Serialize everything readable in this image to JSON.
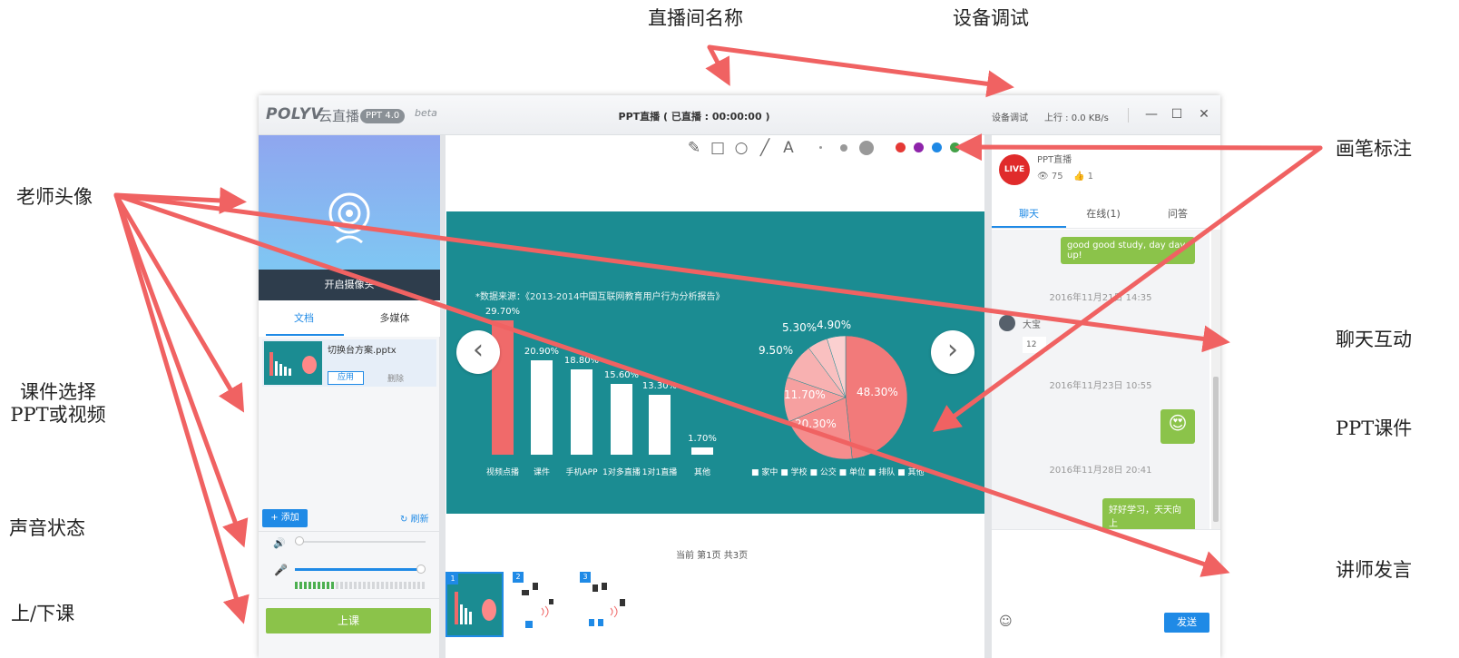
{
  "annotations": {
    "room_name": "直播间名称",
    "device_test": "设备调试",
    "teacher_avatar": "老师头像",
    "courseware_select_1": "课件选择",
    "courseware_select_2": "PPT或视频",
    "sound_status": "声音状态",
    "class_toggle": "上/下课",
    "pen_annotation": "画笔标注",
    "chat_interaction": "聊天互动",
    "ppt_courseware": "PPT课件",
    "teacher_speech": "讲师发言"
  },
  "titlebar": {
    "logo": "POLYV",
    "logo_cn": "云直播",
    "version": "PPT 4.0",
    "beta": "beta",
    "title": "PPT直播 ( 已直播 : 00:00:00 )",
    "device_test": "设备调试",
    "upload_speed": "上行 : 0.0 KB/s"
  },
  "left": {
    "camera_button": "开启摄像头",
    "tabs": [
      "文档",
      "多媒体"
    ],
    "doc_name": "切换台方案.pptx",
    "apply": "应用",
    "delete": "删除",
    "add": "+ 添加",
    "refresh": "刷新",
    "speaker_level": 0.0,
    "mic_level": 1.0,
    "class_button": "上课"
  },
  "toolbar": {
    "tools": [
      "pencil-icon",
      "rectangle-icon",
      "circle-icon",
      "line-icon",
      "text-icon"
    ],
    "colors": [
      "#e53935",
      "#8e24aa",
      "#1e88e5",
      "#43a047",
      "#fb8c00",
      "#263238",
      "#ffffff"
    ],
    "undo": "undo-icon",
    "clear": "close-icon",
    "delete": "trash-icon"
  },
  "slide": {
    "source": "*数据来源：《2013-2014中国互联网教育用户行为分析报告》",
    "bars": [
      {
        "label": "视频点播",
        "value": "29.70%"
      },
      {
        "label": "课件",
        "value": "20.90%"
      },
      {
        "label": "手机APP",
        "value": "18.80%"
      },
      {
        "label": "1对多直播",
        "value": "15.60%"
      },
      {
        "label": "1对1直播",
        "value": "13.30%"
      },
      {
        "label": "其他",
        "value": "1.70%"
      }
    ],
    "pie_labels": [
      "48.30%",
      "20.30%",
      "11.70%",
      "9.50%",
      "5.30%",
      "4.90%"
    ],
    "legend": "■ 家中  ■ 学校  ■ 公交  ■ 单位  ■ 排队  ■ 其他"
  },
  "chart_data": {
    "type": "bar",
    "categories": [
      "视频点播",
      "课件",
      "手机APP",
      "1对多直播",
      "1对1直播",
      "其他"
    ],
    "values": [
      29.7,
      20.9,
      18.8,
      15.6,
      13.3,
      1.7
    ],
    "title": "",
    "xlabel": "",
    "ylabel": "",
    "pie": {
      "values": [
        48.3,
        20.3,
        11.7,
        9.5,
        5.3,
        4.9
      ],
      "legend": [
        "家中",
        "学校",
        "公交",
        "单位",
        "排队",
        "其他"
      ]
    }
  },
  "center": {
    "page_info": "当前 第1页  共3页",
    "thumbs": [
      "1",
      "2",
      "3"
    ]
  },
  "right": {
    "room_name": "PPT直播",
    "views": "75",
    "likes": "1",
    "tabs": [
      "聊天",
      "在线(1)",
      "问答"
    ],
    "msg1": "good good study, day day up!",
    "ts1": "2016年11月21日 14:35",
    "user": "大宝",
    "ts2": "2016年11月23日 10:55",
    "ts3": "2016年11月28日 20:41",
    "msg3": "好好学习，天天向上",
    "send": "发送"
  }
}
